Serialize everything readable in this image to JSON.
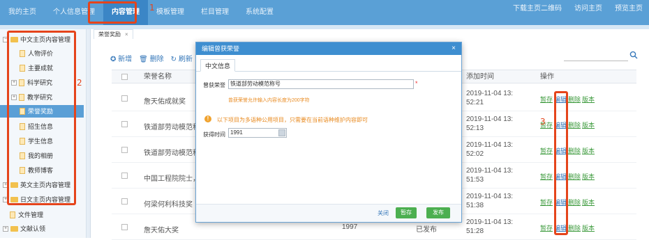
{
  "topnav": [
    "我的主页",
    "个人信息管理",
    "内容管理",
    "模板管理",
    "栏目管理",
    "系统配置"
  ],
  "topright": [
    "下载主页二维码",
    "访问主页",
    "预览主页"
  ],
  "sidebar": {
    "group1": "中文主页内容管理",
    "items": [
      "人物评价",
      "主要成就",
      "科学研究",
      "教学研究",
      "荣誉奖励",
      "招生信息",
      "学生信息",
      "我的相册",
      "教师博客"
    ],
    "group2": "英文主页内容管理",
    "group3": "日文主页内容管理",
    "extra": [
      "文件管理",
      "文献认领"
    ]
  },
  "tab": {
    "label": "荣誉奖励",
    "close": "×"
  },
  "toolbar": {
    "add": "✪ 新增",
    "delete": "🗑 删除",
    "refresh": "↻ 刷新"
  },
  "table": {
    "headers": {
      "name": "荣誉名称",
      "time": "添加时间",
      "ops": "操作"
    },
    "rows": [
      {
        "name": "詹天佑成就奖",
        "year": "",
        "status": "",
        "time": "2019-11-04 13:52:21"
      },
      {
        "name": "铁道部劳动模范称号",
        "year": "",
        "status": "",
        "time": "2019-11-04 13:52:13"
      },
      {
        "name": "铁道部劳动模范称",
        "year": "",
        "status": "",
        "time": "2019-11-04 13:52:02"
      },
      {
        "name": "中国工程院院士，",
        "year": "",
        "status": "",
        "time": "2019-11-04 13:51:53"
      },
      {
        "name": "何梁何利科技奖",
        "year": "",
        "status": "",
        "time": "2019-11-04 13:51:38"
      },
      {
        "name": "詹天佑大奖",
        "year": "1997",
        "status": "已发布",
        "time": "2019-11-04 13:51:28"
      }
    ],
    "ops": [
      "暂存",
      "编辑",
      "删除",
      "版本"
    ]
  },
  "modal": {
    "title": "编辑曾获荣誉",
    "close": "×",
    "tab": "中文信息",
    "honor_label": "曾获荣誉",
    "honor_value": "铁道部劳动模范称号",
    "honor_required": "*",
    "honor_hint": "曾获荣誉允许输入内容长度为200字符",
    "warn_text": "以下项目为多语种公用项目，只需要在当前语种维护内容即可",
    "warn_icon": "!",
    "time_label": "获得时间",
    "time_value": "1991",
    "btn_close": "关闭",
    "btn_save_draft": "暂存",
    "btn_publish": "发布"
  },
  "annotations": [
    "1",
    "2",
    "3"
  ],
  "colors": {
    "topbar": "#5aa0d6",
    "accent": "#3e8ed0",
    "annotation": "#e5441b",
    "green": "#4caf50",
    "hint": "#e8891e"
  }
}
